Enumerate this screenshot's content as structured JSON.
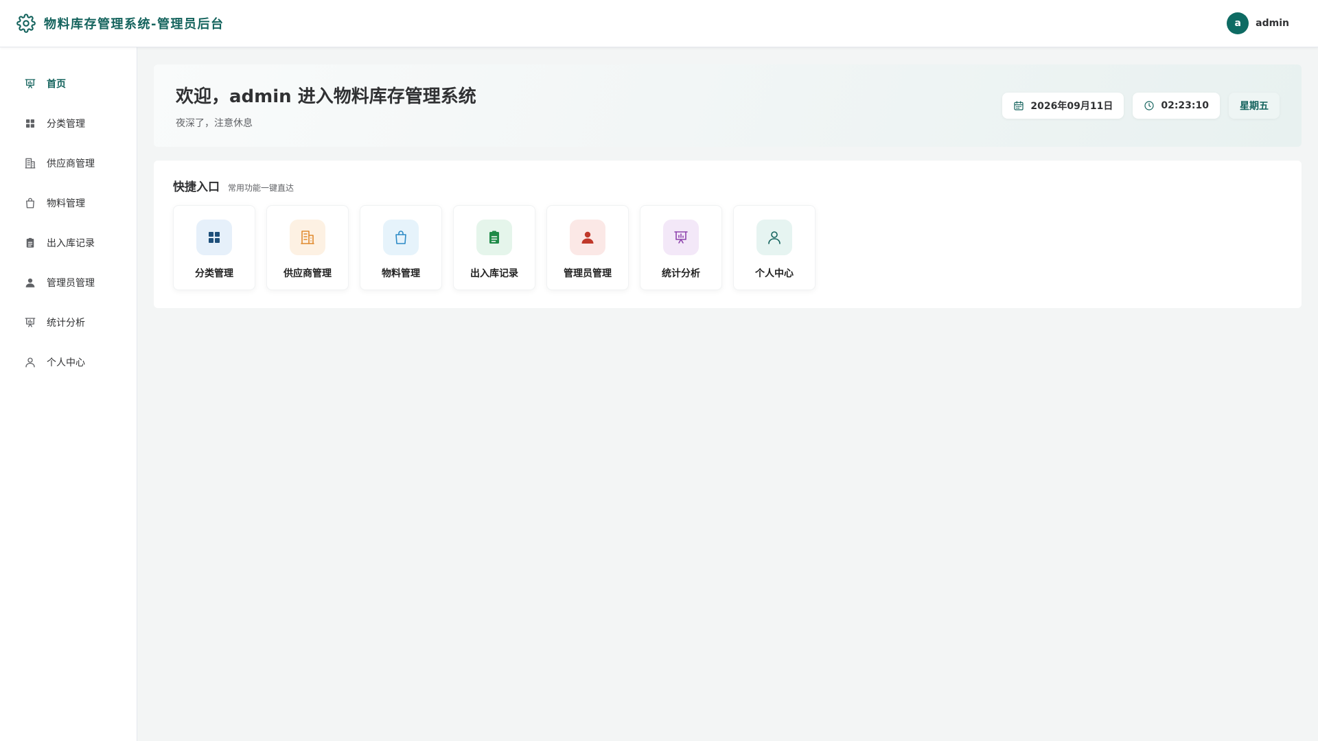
{
  "header": {
    "title": "物料库存管理系统-管理员后台",
    "brand_icon": "gear-icon",
    "user": {
      "avatar_letter": "a",
      "name": "admin"
    }
  },
  "sidebar": {
    "items": [
      {
        "label": "首页",
        "icon": "presentation-chart-icon",
        "active": true
      },
      {
        "label": "分类管理",
        "icon": "grid-icon"
      },
      {
        "label": "供应商管理",
        "icon": "building-icon"
      },
      {
        "label": "物料管理",
        "icon": "shopping-bag-icon"
      },
      {
        "label": "出入库记录",
        "icon": "clipboard-icon"
      },
      {
        "label": "管理员管理",
        "icon": "user-filled-icon"
      },
      {
        "label": "统计分析",
        "icon": "presentation-chart-icon"
      },
      {
        "label": "个人中心",
        "icon": "user-outline-icon"
      }
    ]
  },
  "welcome": {
    "title": "欢迎，admin 进入物料库存管理系统",
    "subtitle": "夜深了，注意休息",
    "date": "2026年09月11日",
    "time": "02:23:10",
    "weekday": "星期五"
  },
  "quick": {
    "title": "快捷入口",
    "subtitle": "常用功能一键直达",
    "tiles": [
      {
        "label": "分类管理",
        "icon": "grid-icon",
        "color": "#1e4f7a",
        "bg": "#e6f0fa"
      },
      {
        "label": "供应商管理",
        "icon": "building-icon",
        "color": "#e08a2e",
        "bg": "#fdf1e3"
      },
      {
        "label": "物料管理",
        "icon": "shopping-bag-icon",
        "color": "#2b8ac6",
        "bg": "#e6f3fb"
      },
      {
        "label": "出入库记录",
        "icon": "clipboard-icon",
        "color": "#1e8a47",
        "bg": "#e5f5eb"
      },
      {
        "label": "管理员管理",
        "icon": "user-filled-icon",
        "color": "#c0392b",
        "bg": "#fbe8e6"
      },
      {
        "label": "统计分析",
        "icon": "presentation-chart-icon",
        "color": "#8e44ad",
        "bg": "#f3e8f8"
      },
      {
        "label": "个人中心",
        "icon": "user-outline-icon",
        "color": "#14635d",
        "bg": "#e6f4f1"
      }
    ]
  },
  "colors": {
    "primary": "#14635d",
    "avatar": "#0e6b63"
  }
}
